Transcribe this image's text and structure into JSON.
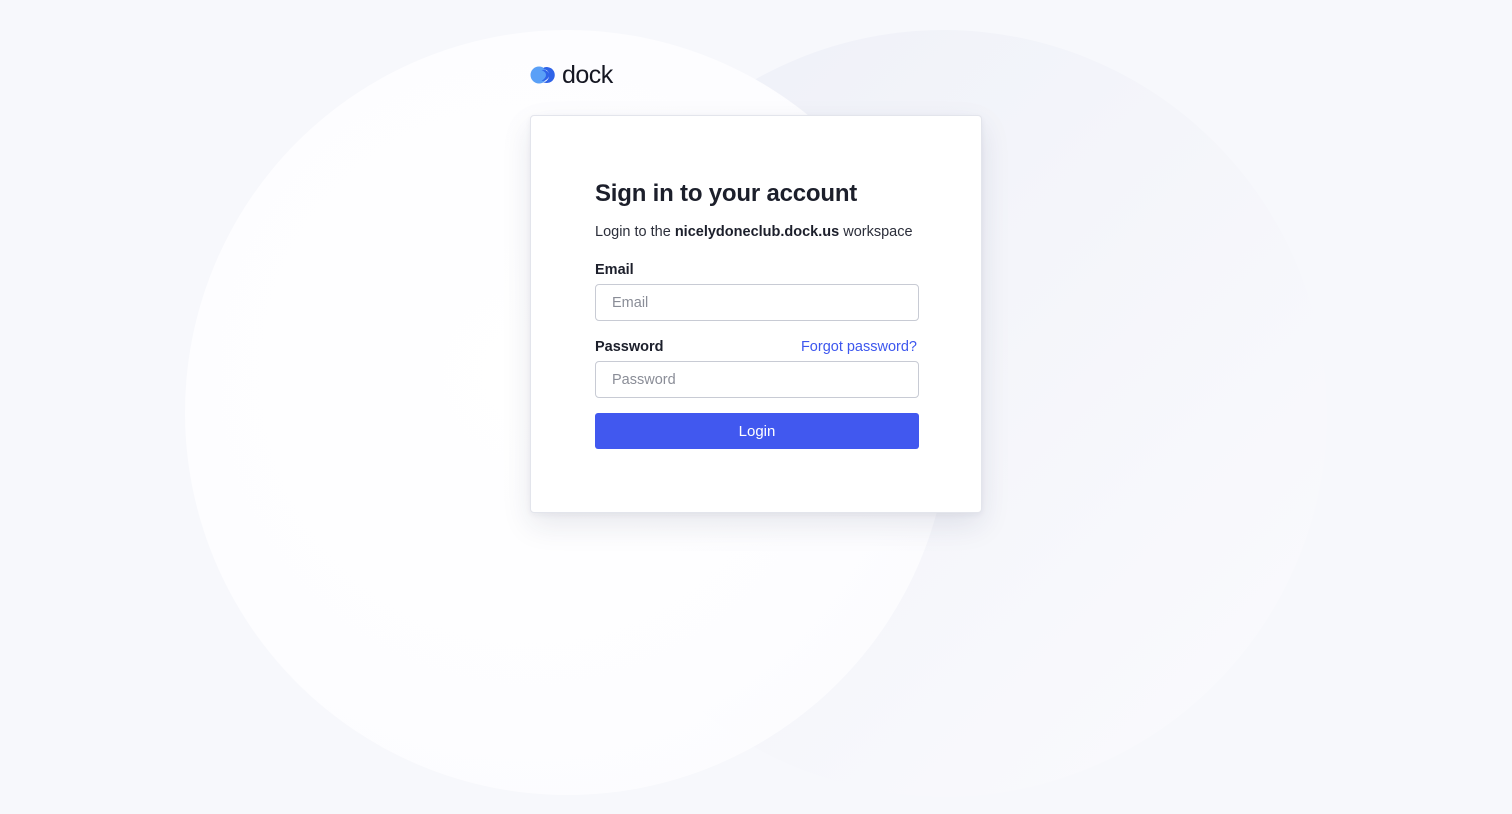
{
  "brand": {
    "name": "dock",
    "logo_icon": "dock-logo-icon",
    "colors": {
      "logo_light": "#5aa0f7",
      "logo_dark": "#2f63e8",
      "accent": "#4158ef",
      "link": "#3d57ee"
    }
  },
  "login": {
    "title": "Sign in to your account",
    "subtitle_prefix": "Login to the ",
    "workspace": "nicelydoneclub.dock.us",
    "subtitle_suffix": " workspace",
    "email": {
      "label": "Email",
      "placeholder": "Email",
      "value": ""
    },
    "password": {
      "label": "Password",
      "placeholder": "Password",
      "value": "",
      "forgot_label": "Forgot password?"
    },
    "submit_label": "Login"
  }
}
